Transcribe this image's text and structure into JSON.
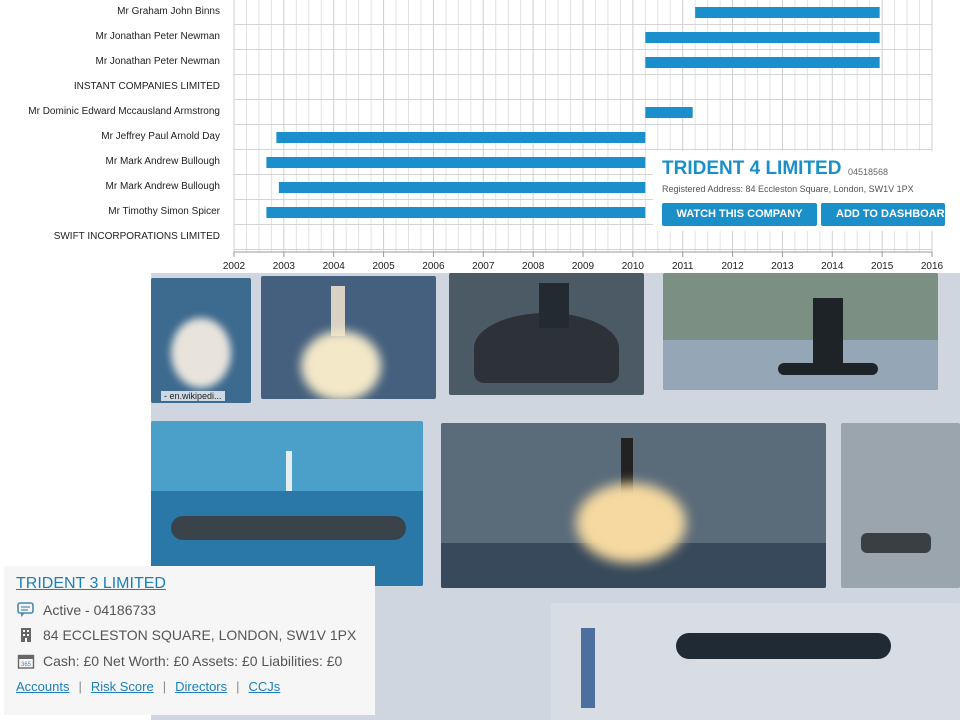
{
  "gantt": {
    "years": [
      "2002",
      "2003",
      "2004",
      "2005",
      "2006",
      "2007",
      "2008",
      "2009",
      "2010",
      "2011",
      "2012",
      "2013",
      "2014",
      "2015",
      "2016"
    ],
    "rows": [
      {
        "name": "Mr Graham John Binns",
        "start": 2011.25,
        "end": 2014.95
      },
      {
        "name": "Mr Jonathan Peter Newman",
        "start": 2010.25,
        "end": 2014.95
      },
      {
        "name": "Mr Jonathan Peter Newman",
        "start": 2010.25,
        "end": 2014.95
      },
      {
        "name": "INSTANT COMPANIES LIMITED",
        "start": null,
        "end": null
      },
      {
        "name": "Mr Dominic Edward Mccausland Armstrong",
        "start": 2010.25,
        "end": 2011.2
      },
      {
        "name": "Mr Jeffrey Paul Arnold Day",
        "start": 2002.85,
        "end": 2010.25
      },
      {
        "name": "Mr Mark Andrew Bullough",
        "start": 2002.65,
        "end": 2010.25
      },
      {
        "name": "Mr Mark Andrew Bullough",
        "start": 2002.9,
        "end": 2010.25
      },
      {
        "name": "Mr Timothy Simon Spicer",
        "start": 2002.65,
        "end": 2010.25
      },
      {
        "name": "SWIFT INCORPORATIONS LIMITED",
        "start": null,
        "end": null
      }
    ],
    "bar_color": "#1b8fcb"
  },
  "card4": {
    "title": "TRIDENT 4 LIMITED",
    "number": "04518568",
    "address": "Registered Address: 84 Eccleston Square, London, SW1V 1PX",
    "watch_label": "WATCH THIS COMPANY",
    "dashboard_label": "ADD TO DASHBOARD"
  },
  "photo": {
    "caption": "- en.wikipedi..."
  },
  "card3": {
    "title": "TRIDENT 3 LIMITED",
    "status": "Active - 04186733",
    "address": "84 ECCLESTON SQUARE, LONDON, SW1V 1PX",
    "financials": "Cash: £0 Net Worth: £0 Assets: £0 Liabilities: £0",
    "links": [
      "Accounts",
      "Risk Score",
      "Directors",
      "CCJs"
    ]
  }
}
